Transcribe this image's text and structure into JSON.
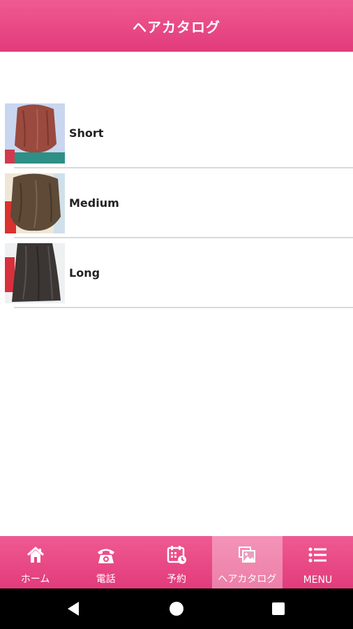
{
  "header": {
    "title": "ヘアカタログ"
  },
  "catalog": {
    "items": [
      {
        "label": "Short"
      },
      {
        "label": "Medium"
      },
      {
        "label": "Long"
      }
    ]
  },
  "tabbar": {
    "active_index": 3,
    "tabs": [
      {
        "label": "ホーム",
        "icon": "home-icon"
      },
      {
        "label": "電話",
        "icon": "phone-icon"
      },
      {
        "label": "予約",
        "icon": "calendar-icon"
      },
      {
        "label": "ヘアカタログ",
        "icon": "gallery-icon"
      },
      {
        "label": "MENU",
        "icon": "menu-list-icon"
      }
    ]
  },
  "colors": {
    "accent": "#e8467f",
    "text": "#222222",
    "divider": "#d9d9d9"
  }
}
